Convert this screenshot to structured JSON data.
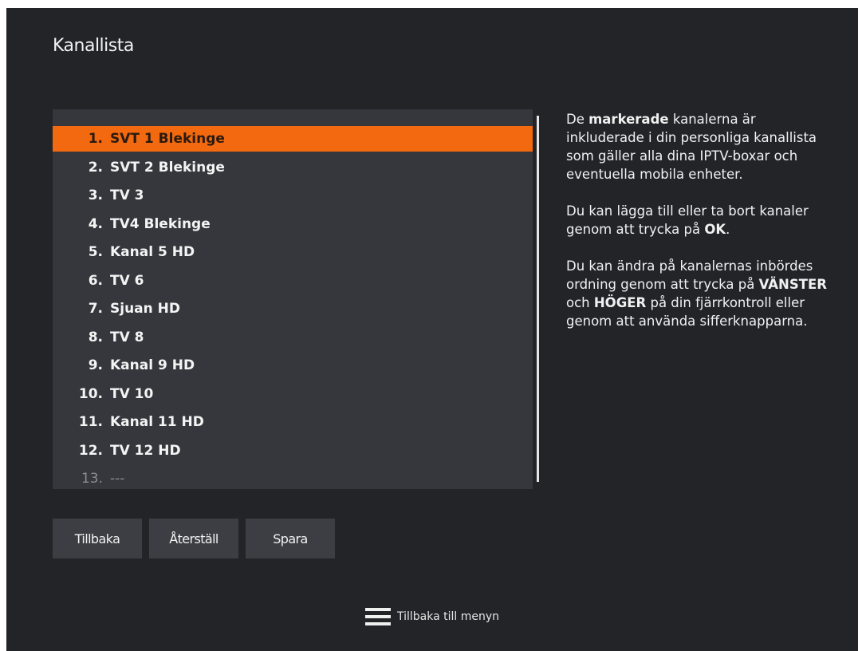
{
  "screen": {
    "title": "Kanallista"
  },
  "channel_list": {
    "items": [
      {
        "num": "1.",
        "name": "SVT 1 Blekinge",
        "selected": true
      },
      {
        "num": "2.",
        "name": "SVT 2 Blekinge"
      },
      {
        "num": "3.",
        "name": "TV 3"
      },
      {
        "num": "4.",
        "name": "TV4 Blekinge"
      },
      {
        "num": "5.",
        "name": "Kanal 5 HD"
      },
      {
        "num": "6.",
        "name": "TV 6"
      },
      {
        "num": "7.",
        "name": "Sjuan HD"
      },
      {
        "num": "8.",
        "name": "TV 8"
      },
      {
        "num": "9.",
        "name": "Kanal 9 HD"
      },
      {
        "num": "10.",
        "name": "TV 10"
      },
      {
        "num": "11.",
        "name": "Kanal 11 HD"
      },
      {
        "num": "12.",
        "name": "TV 12 HD"
      },
      {
        "num": "13.",
        "name": "---",
        "disabled": true
      }
    ]
  },
  "info": {
    "p1": {
      "pre": "De ",
      "bold": "markerade",
      "post": " kanalerna är inkluderade i din personliga kanallista som gäller alla dina IPTV-boxar och eventuella mobila enheter."
    },
    "p2": {
      "pre": "Du kan lägga till eller ta bort kanaler genom att trycka på ",
      "bold": "OK",
      "post": "."
    },
    "p3": {
      "pre": "Du kan ändra på kanalernas inbördes ordning genom att trycka på ",
      "bold1": "VÄNSTER",
      "mid": " och ",
      "bold2": "HÖGER",
      "post": " på din fjärrkontroll eller genom att använda sifferknapparna."
    }
  },
  "buttons": {
    "back": "Tillbaka",
    "reset": "Återställ",
    "save": "Spara"
  },
  "footer": {
    "icon": "menu-icon",
    "label": "Tillbaka till menyn"
  },
  "colors": {
    "highlight": "#f2690f",
    "background": "#222428",
    "panel": "#35373c"
  }
}
